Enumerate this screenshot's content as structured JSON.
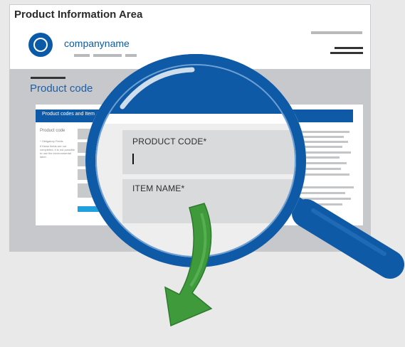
{
  "header": {
    "title": "Product Information Area",
    "company_name": "companyname"
  },
  "section": {
    "title": "Product code"
  },
  "inner_panel": {
    "header_text": "Product codes and Item",
    "side_label": "Product code",
    "side_note": "* Obligatory Fields",
    "side_note_detail": "If these fields are not completed, it is not possible to use the environmental label."
  },
  "magnified": {
    "product_code_label": "PRODUCT CODE",
    "item_name_label": "ITEM NAME",
    "required_marker": "*"
  },
  "colors": {
    "brand_blue": "#0e5aa7",
    "accent_blue": "#20a0dc",
    "arrow_green": "#3f9a3c",
    "background": "#e9e9e9"
  },
  "icons": [
    "blue-angel-logo-icon",
    "magnifying-glass-icon",
    "down-arrow-icon"
  ]
}
